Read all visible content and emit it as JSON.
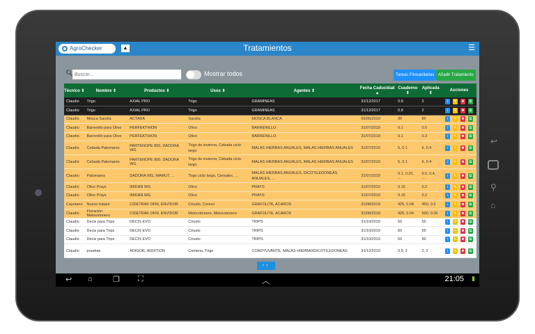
{
  "app": {
    "logo": "AgroChecker",
    "title": "Tratamientos",
    "menu_icon": "hamburger-icon"
  },
  "toolbar": {
    "search_placeholder": "Buscar...",
    "toggle_label": "Mostrar todos",
    "btn_tareas": "Tareas Fitosanitarias",
    "btn_anadir": "Añadir Tratamiento",
    "btn_tareas_color": "#1e90ff",
    "btn_anadir_color": "#28a745"
  },
  "table": {
    "headers": [
      "Técnico ⇕",
      "Nombre ⇕",
      "Productos ⇕",
      "Usos ⇕",
      "Agentes ⇕",
      "Fecha Caducidad ▴",
      "Cuaderno ⇕",
      "Aplicada ⇕",
      "Acciones"
    ],
    "rows": [
      {
        "style": "dark",
        "cells": [
          "Claudio",
          "Trigo",
          "AXIAL PRO",
          "Trigo",
          "GRAMINEAS",
          "31/12/2017",
          "0.8",
          "2"
        ]
      },
      {
        "style": "dark",
        "cells": [
          "Claudio",
          "Trigo",
          "AXIAL PRO",
          "Trigo",
          "GRAMINEAS",
          "31/12/2017",
          "0.8",
          "2"
        ]
      },
      {
        "style": "yel",
        "cells": [
          "Claudio",
          "Mosca Sandía",
          "ACTARA",
          "Sandía",
          "MOSCA BLANCA",
          "06/05/2019",
          "30",
          "50"
        ]
      },
      {
        "style": "yel",
        "cells": [
          "Claudio",
          "Barrenillo para Olivo",
          "PERFEKTHION",
          "Olivo",
          "BARRENILLO",
          "31/07/2019",
          "0.1",
          "0.5"
        ]
      },
      {
        "style": "yel",
        "cells": [
          "Claudio",
          "Barrenillo para Olivo",
          "PERFEKTHION",
          "Olivo",
          "BARRENILLO",
          "31/07/2019",
          "0.1",
          "0.3"
        ]
      },
      {
        "style": "yel",
        "cells": [
          "Claudio",
          "Cebada Palomares",
          "PARTENOPE 800, DADORA WG",
          "Trigo de invierno, Cebada ciclo largo",
          "MALAS HIERBAS ANUALES, MALAS HIERBAS ANUALES",
          "31/07/2019",
          "5, 0.1",
          "6, 0.4"
        ]
      },
      {
        "style": "yel",
        "cells": [
          "Claudio",
          "Cebada Palomares",
          "PARTENOPE 800, DADORA WG",
          "Trigo de invierno, Cebada ciclo largo",
          "MALAS HIERBAS ANUALES, MALAS HIERBAS ANUALES",
          "31/07/2019",
          "5, 0.1",
          "6, 0.4"
        ]
      },
      {
        "style": "yel",
        "cells": [
          "Claudio",
          "Palomares",
          "DADORA WG, MAMUT, ...",
          "Trigo ciclo largo, Cereales, ...",
          "MALAS HIERBAS ANUALES, DICOTILEDONEAS ANUALES, ...",
          "31/07/2019",
          "0.1, 0.20, ...",
          "0.5, 0.4, ..."
        ]
      },
      {
        "style": "yel",
        "cells": [
          "Claudio",
          "Olivo Prays",
          "IMIDAN WG",
          "Olivo",
          "PRAYS",
          "31/07/2019",
          "0.15",
          "0.2"
        ]
      },
      {
        "style": "yel",
        "cells": [
          "Claudio",
          "Olivo Prays",
          "IMIDAN WG",
          "Olivo",
          "PRAYS",
          "31/07/2019",
          "0.15",
          "0.2"
        ]
      },
      {
        "style": "yel",
        "cells": [
          "Cayetano",
          "Nuevo tratam",
          "CIDETRAK OFM, ENVIDOR",
          "Ciruelo, Cerezo",
          "GRAFOLITA, ACAROS",
          "31/08/2019",
          "425, 0.04",
          "450, 0.5"
        ]
      },
      {
        "style": "yel",
        "cells": [
          "Claudio",
          "Floración Melocotonero",
          "CIDETRAK OFM, ENVIDOR",
          "Melocotonero, Melocotonero",
          "GRAFOLITA, ACAROS",
          "31/08/2019",
          "425, 0.04",
          "500, 0.06"
        ]
      },
      {
        "style": "wht",
        "cells": [
          "Claudio",
          "Decis para Trips",
          "DECIS EVO",
          "Ciruelo",
          "TRIPS",
          "31/10/2019",
          "50",
          "55"
        ]
      },
      {
        "style": "wht",
        "cells": [
          "Claudio",
          "Decis para Trips",
          "DECIS EVO",
          "Ciruelo",
          "TRIPS",
          "31/10/2019",
          "50",
          "55"
        ]
      },
      {
        "style": "wht",
        "cells": [
          "Claudio",
          "Decis para Trips",
          "DECIS EVO",
          "Ciruelo",
          "TRIPS",
          "31/10/2019",
          "50",
          "60"
        ]
      },
      {
        "style": "wht",
        "cells": [
          "Claudio",
          "pruebas",
          "ADIGOR, ADDITION",
          "Centeno, Trigo",
          "COADYUVANTE, MALAS HIERBASDICOTILEDONEAS",
          "31/12/2019",
          "0.5, 2",
          "2, 2"
        ]
      }
    ],
    "actions": [
      {
        "icon": "info-icon",
        "glyph": "i",
        "color": "#1e90ff"
      },
      {
        "icon": "edit-icon",
        "glyph": "✎",
        "color": "#f5c000"
      },
      {
        "icon": "delete-icon",
        "glyph": "✖",
        "color": "#dc3545"
      },
      {
        "icon": "copy-icon",
        "glyph": "⧉",
        "color": "#28a745"
      }
    ]
  },
  "pager": {
    "prev": "‹",
    "next": "›"
  },
  "statusbar": {
    "time": "21:05"
  }
}
